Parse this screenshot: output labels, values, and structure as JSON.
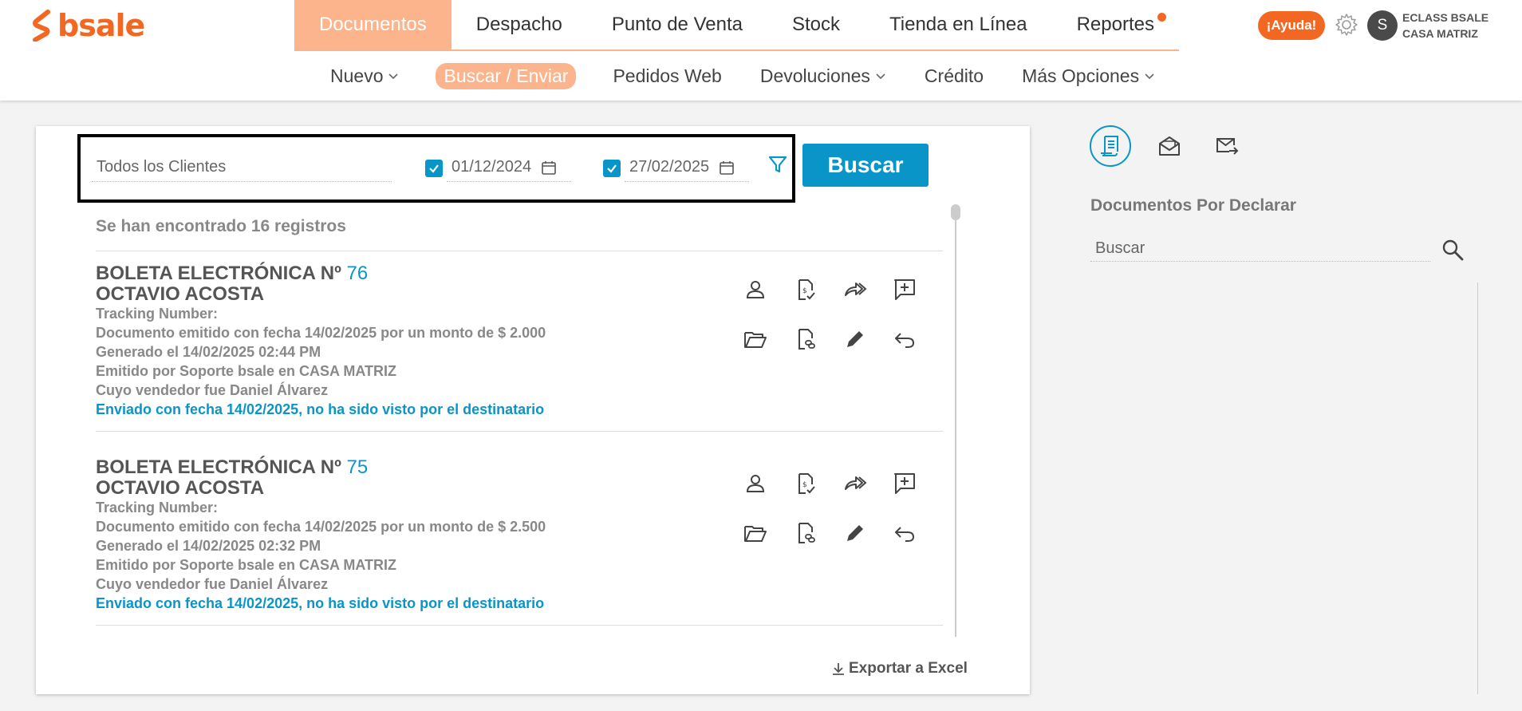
{
  "brand": {
    "name": "bsale",
    "color": "#f26722",
    "accent": "#0a95c8"
  },
  "main_nav": [
    {
      "label": "Documentos",
      "active": true
    },
    {
      "label": "Despacho"
    },
    {
      "label": "Punto de Venta"
    },
    {
      "label": "Stock"
    },
    {
      "label": "Tienda en Línea"
    },
    {
      "label": "Reportes",
      "badge": true
    }
  ],
  "header": {
    "help_label": "¡Ayuda!",
    "avatar_letter": "S",
    "company_name": "ECLASS BSALE",
    "branch": "CASA MATRIZ"
  },
  "sub_nav": [
    {
      "label": "Nuevo",
      "dropdown": true
    },
    {
      "label": "Buscar / Enviar",
      "active": true
    },
    {
      "label": "Pedidos Web"
    },
    {
      "label": "Devoluciones",
      "dropdown": true
    },
    {
      "label": "Crédito"
    },
    {
      "label": "Más Opciones",
      "dropdown": true
    }
  ],
  "search": {
    "client_value": "Todos los Clientes",
    "date_from": "01/12/2024",
    "date_from_checked": true,
    "date_to": "27/02/2025",
    "date_to_checked": true,
    "button_label": "Buscar"
  },
  "results": {
    "count_text": "Se han encontrado 16 registros",
    "documents": [
      {
        "title": "BOLETA ELECTRÓNICA Nº",
        "number": "76",
        "client": "OCTAVIO ACOSTA",
        "tracking": "Tracking Number:",
        "issued": "Documento emitido con fecha 14/02/2025 por un monto de $ 2.000",
        "generated": "Generado el 14/02/2025 02:44 PM",
        "emitted_by": "Emitido por Soporte bsale en CASA MATRIZ",
        "seller": "Cuyo vendedor fue Daniel Álvarez",
        "sent": "Enviado con fecha 14/02/2025, no ha sido visto por el destinatario"
      },
      {
        "title": "BOLETA ELECTRÓNICA Nº",
        "number": "75",
        "client": "OCTAVIO ACOSTA",
        "tracking": "Tracking Number:",
        "issued": "Documento emitido con fecha 14/02/2025 por un monto de $ 2.500",
        "generated": "Generado el 14/02/2025 02:32 PM",
        "emitted_by": "Emitido por Soporte bsale en CASA MATRIZ",
        "seller": "Cuyo vendedor fue Daniel Álvarez",
        "sent": "Enviado con fecha 14/02/2025, no ha sido visto por el destinatario"
      }
    ],
    "row_icons": [
      "person-icon",
      "document-dollar-check-icon",
      "forward-icon",
      "add-comment-icon",
      "folder-open-icon",
      "document-link-icon",
      "pencil-icon",
      "undo-icon"
    ],
    "export_label": "Exportar a Excel"
  },
  "side": {
    "tabs": [
      "document-receipt-icon",
      "mail-open-icon",
      "mail-send-icon"
    ],
    "title": "Documentos Por Declarar",
    "search_placeholder": "Buscar"
  }
}
